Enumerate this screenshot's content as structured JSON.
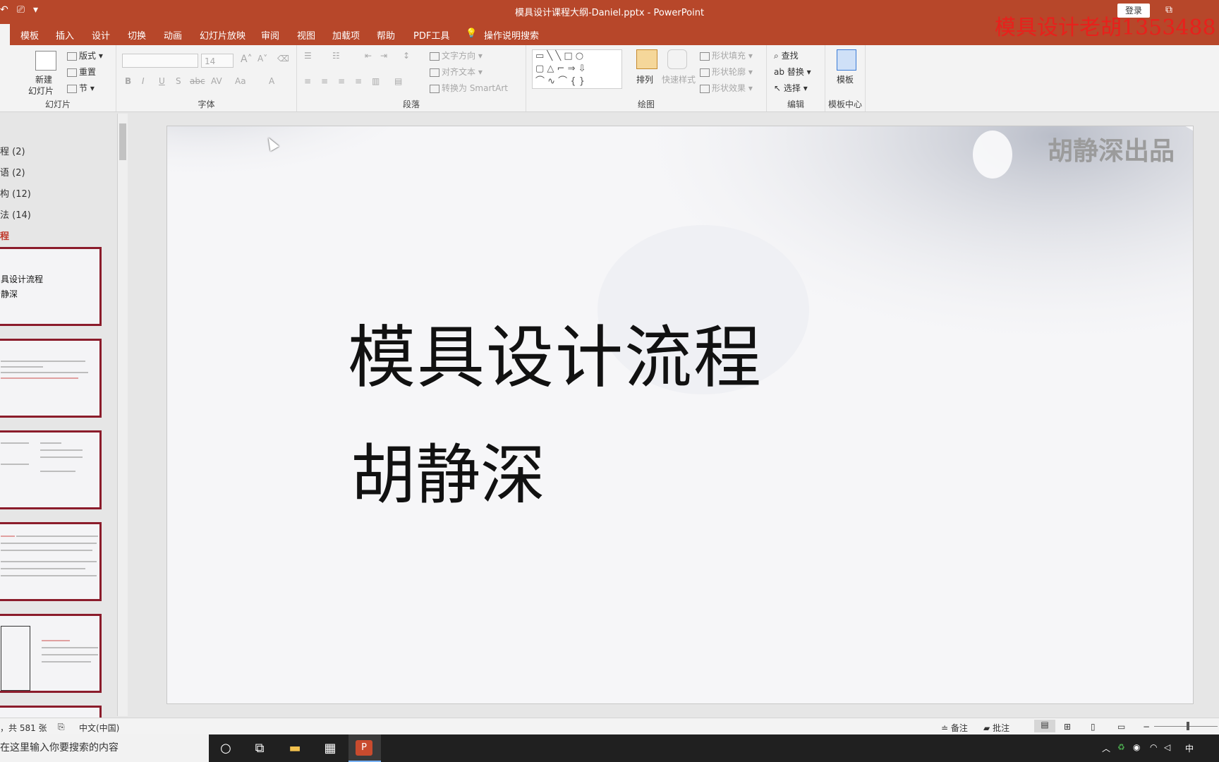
{
  "app": {
    "window_title": "模具设计课程大纲-Daniel.pptx  -  PowerPoint",
    "login_label": "登录",
    "restore_icon": "restore-window-icon",
    "overlay_watermark": "模具设计老胡1353488"
  },
  "tabs": [
    "模板",
    "插入",
    "设计",
    "切换",
    "动画",
    "幻灯片放映",
    "审阅",
    "视图",
    "加载项",
    "帮助",
    "PDF工具"
  ],
  "tell_me": "操作说明搜索",
  "ribbon": {
    "slides_group": {
      "new_slide": "新建",
      "new_slide2": "幻灯片",
      "layout": "版式",
      "reset": "重置",
      "section": "节",
      "label": "幻灯片"
    },
    "font_group": {
      "font_size": "14",
      "label": "字体"
    },
    "paragraph_group": {
      "text_direction": "文字方向",
      "align_text": "对齐文本",
      "smartart": "转换为 SmartArt",
      "label": "段落"
    },
    "drawing_group": {
      "arrange": "排列",
      "quick_styles": "快速样式",
      "shape_fill": "形状填充",
      "shape_outline": "形状轮廓",
      "shape_effects": "形状效果",
      "label": "绘图"
    },
    "editing_group": {
      "find": "查找",
      "replace": "替换",
      "select": "选择",
      "label": "编辑"
    },
    "template_group": {
      "template": "模板",
      "label": "模板中心"
    }
  },
  "outline": {
    "sections": [
      "程 (2)",
      "语 (2)",
      "构 (12)",
      "法 (14)"
    ],
    "current_section": "程",
    "thumb1_line1": "具设计流程",
    "thumb1_line2": "静深"
  },
  "slide": {
    "watermark": "胡静深出品",
    "title": "模具设计流程",
    "author": "胡静深"
  },
  "status": {
    "slide_count": "，共 581 张",
    "language": "中文(中国)",
    "notes": "备注",
    "comments": "批注"
  },
  "taskbar": {
    "search_placeholder": "在这里输入你要搜索的内容",
    "tray_ime": "中"
  }
}
